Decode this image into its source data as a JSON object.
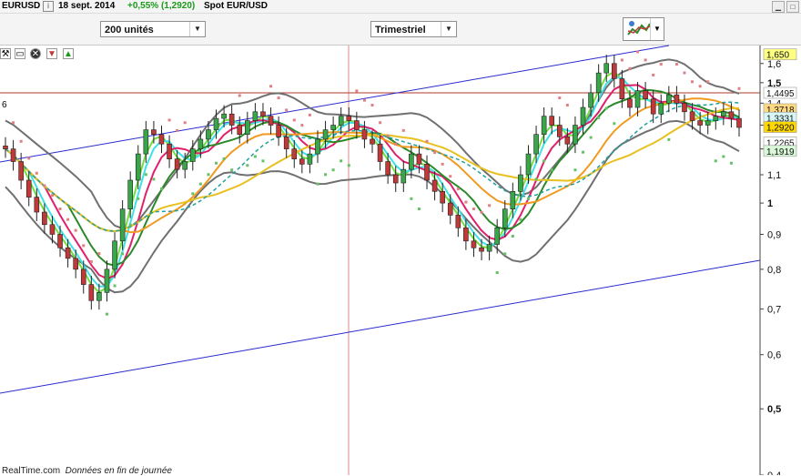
{
  "header": {
    "symbol": "EURUSD",
    "info_icon": "i",
    "date": "18 sept. 2014",
    "change": "+0,55% (1,2920)",
    "name": "Spot EUR/USD"
  },
  "toolbar": {
    "units_select": "200 unités",
    "period_select": "Trimestriel",
    "indicators_icon": "indicators-chart-icon"
  },
  "tools": {
    "wrench_icon": "wrench-icon",
    "window_icon": "window-icon",
    "close_icon": "close-icon",
    "down_icon": "down-arrow-icon",
    "up_icon": "up-arrow-icon"
  },
  "left_label": "6",
  "footer": {
    "source": "RealTime.com",
    "note": "Données en fin de journée"
  },
  "colors": {
    "up_candle": "#3aa64a",
    "down_candle": "#c03838",
    "bollinger": "#707070",
    "channel": "#2a2ad0",
    "hline": "#b23a2a",
    "sar_red": "#e08080",
    "sar_green": "#66c066",
    "ma_cyan": "#40e0e8",
    "ma_lightgreen": "#70e040",
    "ma_darkgreen": "#2a8a2a",
    "ma_magenta": "#e0206a",
    "ma_orange": "#f09a20",
    "ma_yellow": "#e8c020",
    "ma_teal_dashed": "#20a0a0"
  },
  "chart_data": {
    "type": "candlestick",
    "yscale": "log",
    "ylim": [
      0.4,
      1.7
    ],
    "y_ticks": [
      "1,6",
      "1,5",
      "1,4",
      "1,3",
      "1,2",
      "1,1",
      "1",
      "0,9",
      "0,8",
      "0,7",
      "0,6",
      "0,5",
      "0,4"
    ],
    "bold_ticks": [
      "1,5",
      "1",
      "0,5"
    ],
    "price_labels": [
      {
        "text": "1,650",
        "value": 1.65,
        "bg": "#ffff80"
      },
      {
        "text": "1,4495",
        "value": 1.4495,
        "bg": "#ffffff"
      },
      {
        "text": "1,3718",
        "value": 1.3718,
        "bg": "#ffd980"
      },
      {
        "text": "1,3331",
        "value": 1.3331,
        "bg": "#d8f8f8"
      },
      {
        "text": "1,2920",
        "value": 1.292,
        "bg": "#ffd800"
      },
      {
        "text": "1,2265",
        "value": 1.2265,
        "bg": "#ffffff"
      },
      {
        "text": "1,1919",
        "value": 1.1919,
        "bg": "#d8f8d8"
      }
    ],
    "hline": 1.4495,
    "last_close": 1.292,
    "close_series": [
      1.2,
      1.15,
      1.08,
      1.02,
      0.97,
      0.93,
      0.9,
      0.86,
      0.83,
      0.8,
      0.76,
      0.72,
      0.74,
      0.8,
      0.88,
      0.98,
      1.08,
      1.18,
      1.28,
      1.26,
      1.22,
      1.16,
      1.12,
      1.15,
      1.2,
      1.24,
      1.28,
      1.33,
      1.35,
      1.3,
      1.26,
      1.32,
      1.36,
      1.34,
      1.3,
      1.25,
      1.2,
      1.16,
      1.14,
      1.18,
      1.24,
      1.28,
      1.3,
      1.34,
      1.32,
      1.28,
      1.24,
      1.22,
      1.15,
      1.1,
      1.07,
      1.12,
      1.18,
      1.14,
      1.08,
      1.04,
      1.0,
      0.96,
      0.92,
      0.88,
      0.86,
      0.85,
      0.87,
      0.92,
      0.98,
      1.04,
      1.1,
      1.18,
      1.26,
      1.34,
      1.3,
      1.25,
      1.22,
      1.3,
      1.38,
      1.45,
      1.55,
      1.6,
      1.52,
      1.42,
      1.38,
      1.46,
      1.42,
      1.35,
      1.4,
      1.44,
      1.4,
      1.36,
      1.32,
      1.3,
      1.32,
      1.34,
      1.36,
      1.33,
      1.29
    ]
  }
}
